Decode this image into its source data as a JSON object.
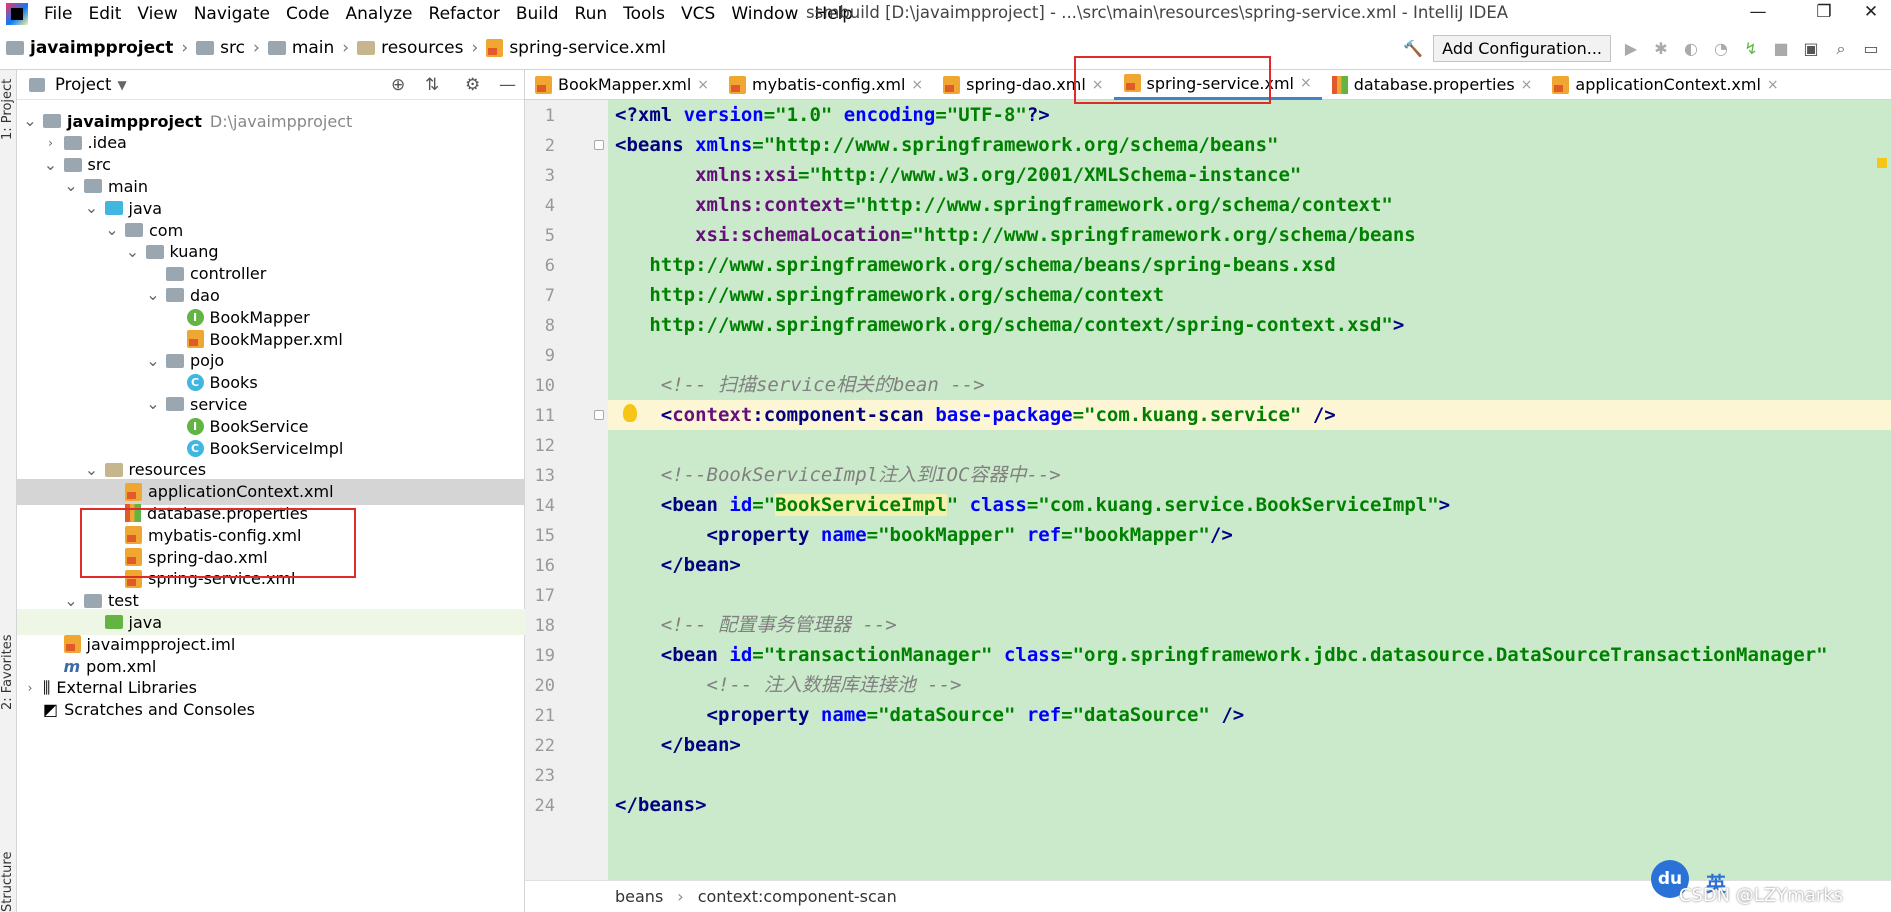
{
  "menubar": {
    "items": [
      "File",
      "Edit",
      "View",
      "Navigate",
      "Code",
      "Analyze",
      "Refactor",
      "Build",
      "Run",
      "Tools",
      "VCS",
      "Window",
      "Help"
    ],
    "title": "ssmbuild [D:\\javaimpproject] - ...\\src\\main\\resources\\spring-service.xml - IntelliJ IDEA",
    "controls": {
      "minimize": "—",
      "restore": "❐",
      "close": "✕"
    }
  },
  "breadcrumb": {
    "items": [
      "javaimpproject",
      "src",
      "main",
      "resources",
      "spring-service.xml"
    ]
  },
  "toolbar": {
    "add_configuration": "Add Configuration..."
  },
  "side_strip": {
    "project_label": "1: Project",
    "favorites_label": "2: Favorites",
    "structure_label": "Structure"
  },
  "project_panel": {
    "title": "Project",
    "tree": [
      {
        "label": "javaimpproject",
        "extra": "D:\\javaimpproject",
        "level": 0,
        "icon": "folder-icon",
        "chev": "down"
      },
      {
        "label": ".idea",
        "level": 1,
        "icon": "folder-icon",
        "chev": "right"
      },
      {
        "label": "src",
        "level": 1,
        "icon": "folder-icon",
        "chev": "down"
      },
      {
        "label": "main",
        "level": 2,
        "icon": "folder-icon",
        "chev": "down"
      },
      {
        "label": "java",
        "level": 3,
        "icon": "source-folder-icon",
        "chev": "down"
      },
      {
        "label": "com",
        "level": 4,
        "icon": "package-icon",
        "chev": "down"
      },
      {
        "label": "kuang",
        "level": 5,
        "icon": "package-icon",
        "chev": "down"
      },
      {
        "label": "controller",
        "level": 6,
        "icon": "package-icon",
        "chev": "none"
      },
      {
        "label": "dao",
        "level": 6,
        "icon": "package-icon",
        "chev": "down"
      },
      {
        "label": "BookMapper",
        "level": 7,
        "icon": "interface-icon",
        "chev": "none"
      },
      {
        "label": "BookMapper.xml",
        "level": 7,
        "icon": "xml-file-icon",
        "chev": "none"
      },
      {
        "label": "pojo",
        "level": 6,
        "icon": "package-icon",
        "chev": "down"
      },
      {
        "label": "Books",
        "level": 7,
        "icon": "class-icon",
        "chev": "none"
      },
      {
        "label": "service",
        "level": 6,
        "icon": "package-icon",
        "chev": "down"
      },
      {
        "label": "BookService",
        "level": 7,
        "icon": "interface-icon",
        "chev": "none"
      },
      {
        "label": "BookServiceImpl",
        "level": 7,
        "icon": "class-icon",
        "chev": "none"
      },
      {
        "label": "resources",
        "level": 3,
        "icon": "resources-folder-icon",
        "chev": "down"
      },
      {
        "label": "applicationContext.xml",
        "level": 4,
        "icon": "xml-file-icon",
        "chev": "none",
        "selected": true
      },
      {
        "label": "database.properties",
        "level": 4,
        "icon": "properties-file-icon",
        "chev": "none"
      },
      {
        "label": "mybatis-config.xml",
        "level": 4,
        "icon": "xml-file-icon",
        "chev": "none"
      },
      {
        "label": "spring-dao.xml",
        "level": 4,
        "icon": "xml-file-icon",
        "chev": "none"
      },
      {
        "label": "spring-service.xml",
        "level": 4,
        "icon": "xml-file-icon",
        "chev": "none"
      },
      {
        "label": "test",
        "level": 2,
        "icon": "folder-icon",
        "chev": "down"
      },
      {
        "label": "java",
        "level": 3,
        "icon": "test-folder-icon",
        "chev": "none",
        "hl": true
      },
      {
        "label": "javaimpproject.iml",
        "level": 1,
        "icon": "iml-file-icon",
        "chev": "none"
      },
      {
        "label": "pom.xml",
        "level": 1,
        "icon": "maven-icon",
        "chev": "none"
      },
      {
        "label": "External Libraries",
        "level": 0,
        "icon": "libraries-icon",
        "chev": "right"
      },
      {
        "label": "Scratches and Consoles",
        "level": 0,
        "icon": "scratches-icon",
        "chev": "none"
      }
    ]
  },
  "editor": {
    "tabs": [
      {
        "label": "BookMapper.xml",
        "active": false
      },
      {
        "label": "mybatis-config.xml",
        "active": false
      },
      {
        "label": "spring-dao.xml",
        "active": false
      },
      {
        "label": "spring-service.xml",
        "active": true
      },
      {
        "label": "database.properties",
        "active": false
      },
      {
        "label": "applicationContext.xml",
        "active": false
      }
    ],
    "current_line": 11,
    "lines": [
      [
        [
          "tg",
          "<?xml "
        ],
        [
          "at",
          "version"
        ],
        [
          "vl",
          "=\"1.0\" "
        ],
        [
          "at",
          "encoding"
        ],
        [
          "vl",
          "=\"UTF-8\""
        ],
        [
          "tg",
          "?>"
        ]
      ],
      [
        [
          "tg",
          "<beans "
        ],
        [
          "at",
          "xmlns"
        ],
        [
          "vl",
          "=\"http://www.springframework.org/schema/beans\""
        ]
      ],
      [
        [
          "tg",
          "       "
        ],
        [
          "nsat",
          "xmlns:xsi"
        ],
        [
          "vl",
          "=\"http://www.w3.org/2001/XMLSchema-instance\""
        ]
      ],
      [
        [
          "tg",
          "       "
        ],
        [
          "nsat",
          "xmlns:context"
        ],
        [
          "vl",
          "=\"http://www.springframework.org/schema/context\""
        ]
      ],
      [
        [
          "tg",
          "       "
        ],
        [
          "nsat",
          "xsi:schemaLocation"
        ],
        [
          "vl",
          "=\"http://www.springframework.org/schema/beans"
        ]
      ],
      [
        [
          "vl",
          "   http://www.springframework.org/schema/beans/spring-beans.xsd"
        ]
      ],
      [
        [
          "vl",
          "   http://www.springframework.org/schema/context"
        ]
      ],
      [
        [
          "vl",
          "   http://www.springframework.org/schema/context/spring-context.xsd\""
        ],
        [
          "tg",
          ">"
        ]
      ],
      [],
      [
        [
          "cm",
          "    <!-- 扫描service相关的bean -->"
        ]
      ],
      [
        [
          "tg",
          "    <"
        ],
        [
          "nsat",
          "context"
        ],
        [
          "tg",
          ":component-scan "
        ],
        [
          "at",
          "base-package"
        ],
        [
          "vl",
          "=\"com.kuang.service\" "
        ],
        [
          "tg",
          "/>"
        ]
      ],
      [],
      [
        [
          "cm",
          "    <!--BookServiceImpl注入到IOC容器中-->"
        ]
      ],
      [
        [
          "tg",
          "    <bean "
        ],
        [
          "at",
          "id"
        ],
        [
          "vl",
          "=\""
        ],
        [
          "vlh",
          "BookServiceImpl"
        ],
        [
          "vl",
          "\" "
        ],
        [
          "at",
          "class"
        ],
        [
          "vl",
          "=\"com.kuang.service.BookServiceImpl\""
        ],
        [
          "tg",
          ">"
        ]
      ],
      [
        [
          "tg",
          "        <property "
        ],
        [
          "at",
          "name"
        ],
        [
          "vl",
          "=\"bookMapper\" "
        ],
        [
          "at",
          "ref"
        ],
        [
          "vl",
          "=\"bookMapper\""
        ],
        [
          "tg",
          "/>"
        ]
      ],
      [
        [
          "tg",
          "    </bean>"
        ]
      ],
      [],
      [
        [
          "cm",
          "    <!-- 配置事务管理器 -->"
        ]
      ],
      [
        [
          "tg",
          "    <bean "
        ],
        [
          "at",
          "id"
        ],
        [
          "vl",
          "=\"transactionManager\" "
        ],
        [
          "at",
          "class"
        ],
        [
          "vl",
          "=\"org.springframework.jdbc.datasource.DataSourceTransactionManager\""
        ]
      ],
      [
        [
          "cm",
          "        <!-- 注入数据库连接池 -->"
        ]
      ],
      [
        [
          "tg",
          "        <property "
        ],
        [
          "at",
          "name"
        ],
        [
          "vl",
          "=\"dataSource\" "
        ],
        [
          "at",
          "ref"
        ],
        [
          "vl",
          "=\"dataSource\" "
        ],
        [
          "tg",
          "/>"
        ]
      ],
      [
        [
          "tg",
          "    </bean>"
        ]
      ],
      [],
      [
        [
          "tg",
          "</beans>"
        ]
      ]
    ]
  },
  "status": {
    "crumbs": [
      "beans",
      "context:component-scan"
    ],
    "crumb_sep": "›"
  },
  "overlay": {
    "watermark": "CSDN @LZYmarks",
    "baidu_logo": "du",
    "ime_label": "英"
  }
}
